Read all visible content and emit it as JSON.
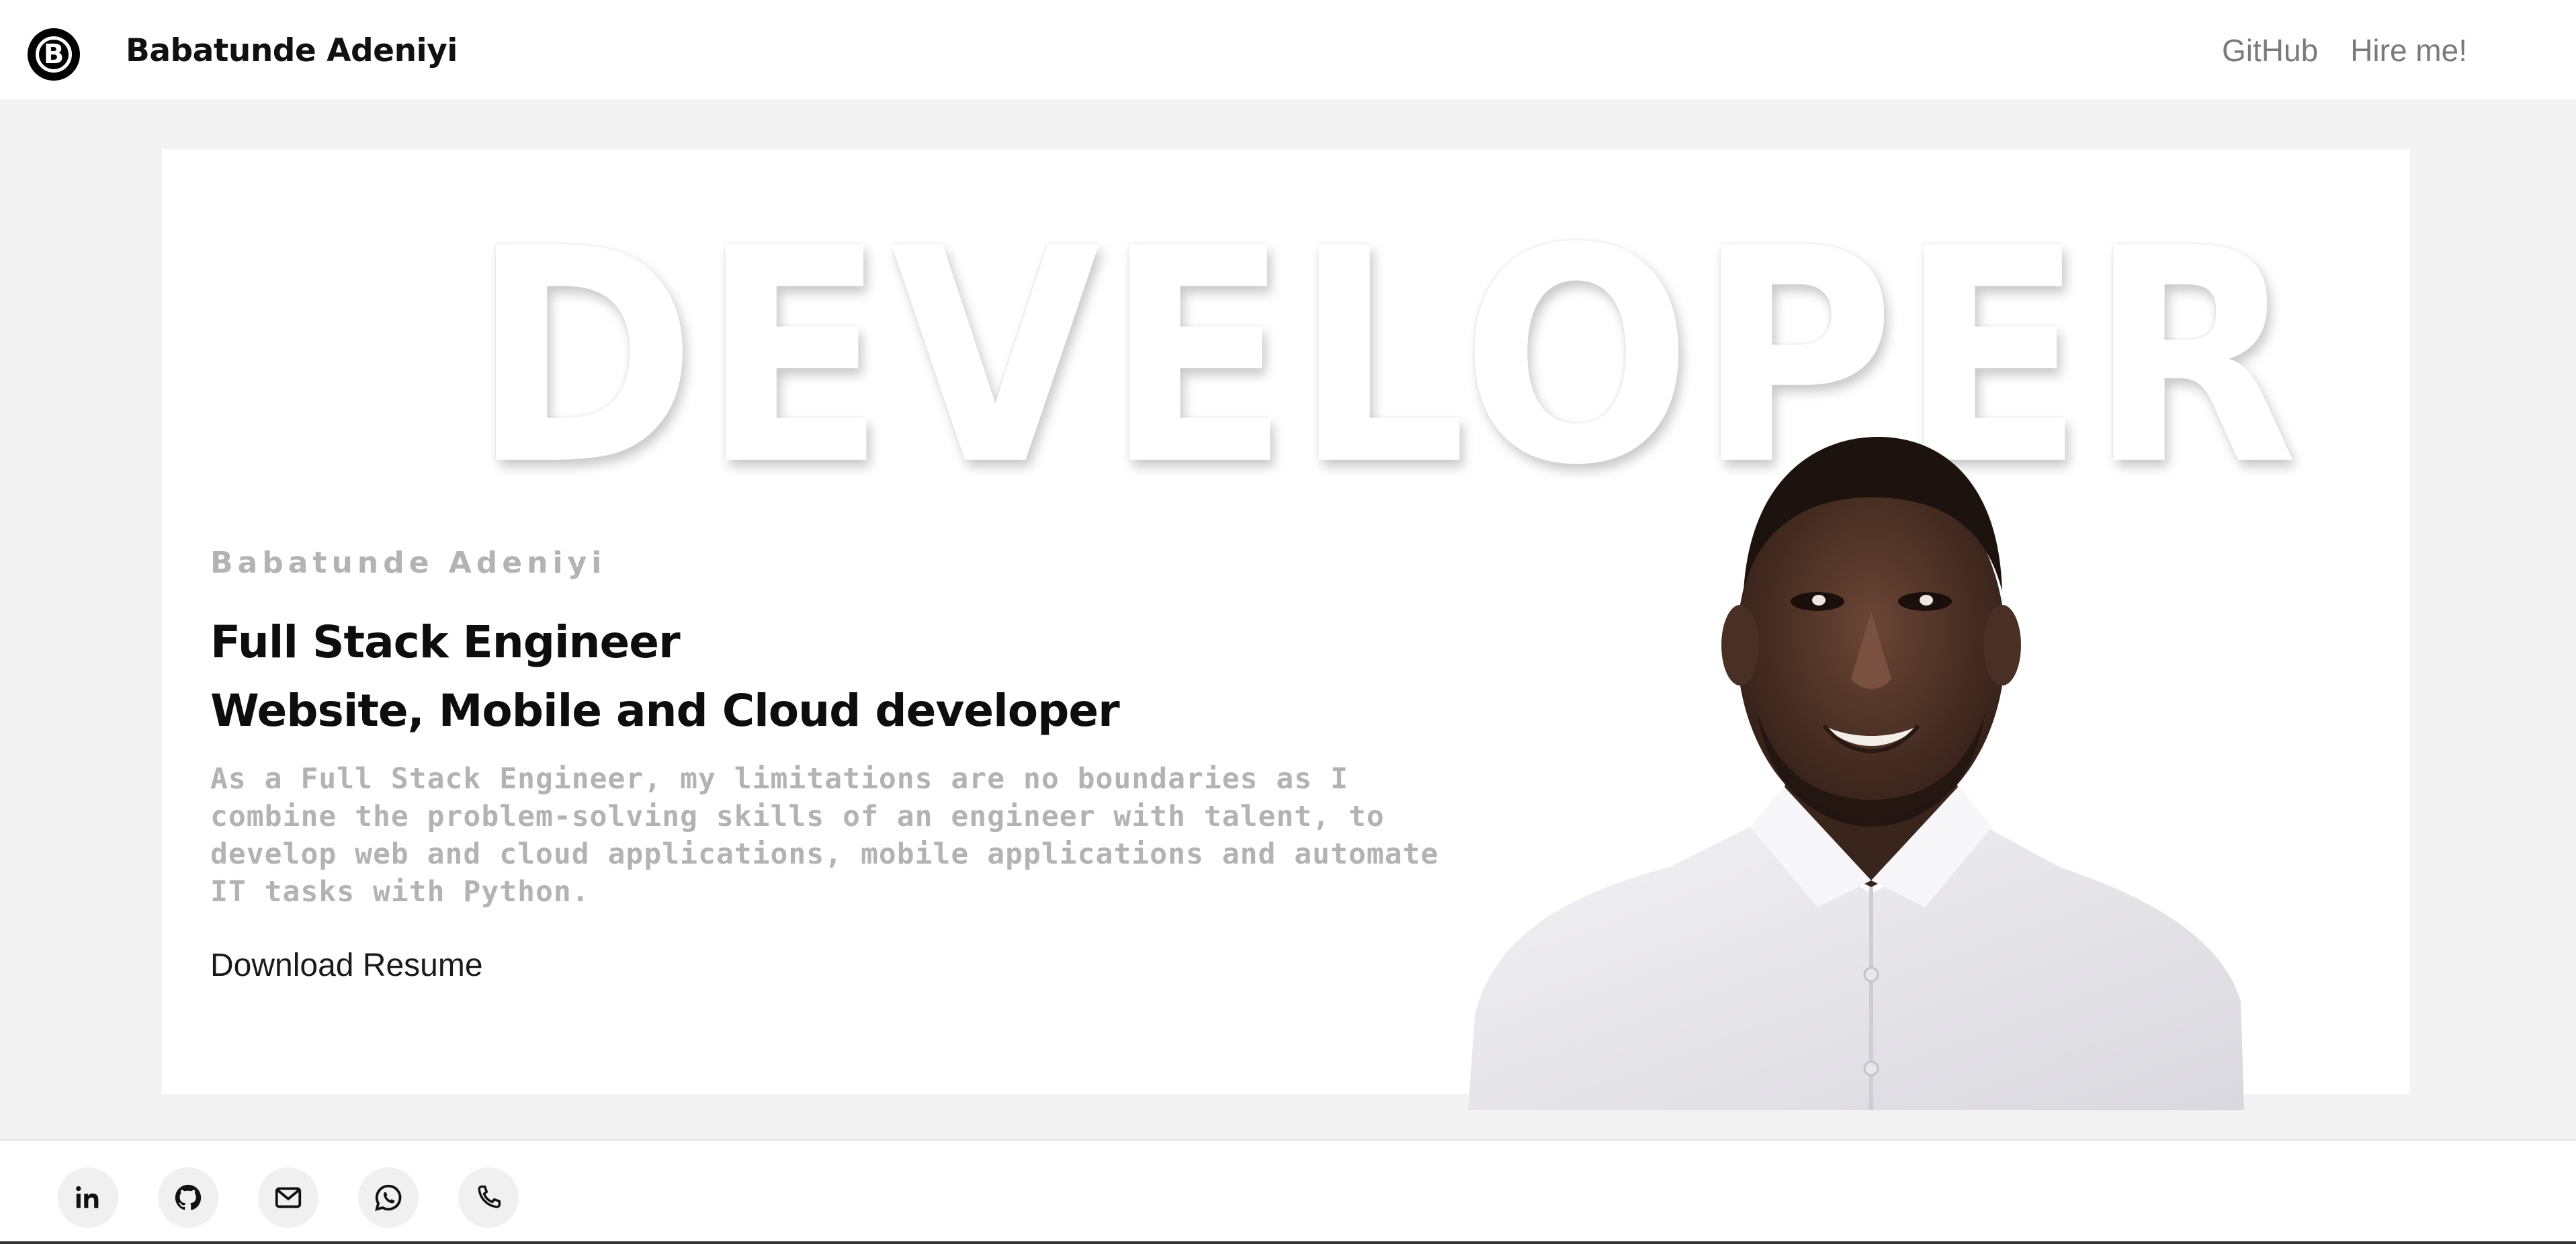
{
  "navbar": {
    "logo_letter": "B",
    "brand_name": "Babatunde Adeniyi",
    "links": [
      {
        "label": "GitHub"
      },
      {
        "label": "Hire me!"
      }
    ]
  },
  "hero": {
    "background_word": "DEVELOPER",
    "name": "Babatunde Adeniyi",
    "title_line_1": "Full Stack Engineer",
    "title_line_2": "Website, Mobile and Cloud developer",
    "description": "As a Full Stack Engineer, my limitations are no boundaries as I combine the problem-solving skills of an engineer with talent, to develop web and cloud applications, mobile applications and automate IT tasks with Python.",
    "download_label": "Download Resume"
  },
  "social": [
    {
      "icon": "linkedin-icon"
    },
    {
      "icon": "github-icon"
    },
    {
      "icon": "mail-icon"
    },
    {
      "icon": "whatsapp-icon"
    },
    {
      "icon": "phone-icon"
    }
  ],
  "colors": {
    "page_background": "#f3f3f3",
    "card_background": "#ffffff",
    "muted_text": "#b3b3b3",
    "nav_link": "#7a7a7a",
    "heading": "#0d0d0d"
  }
}
